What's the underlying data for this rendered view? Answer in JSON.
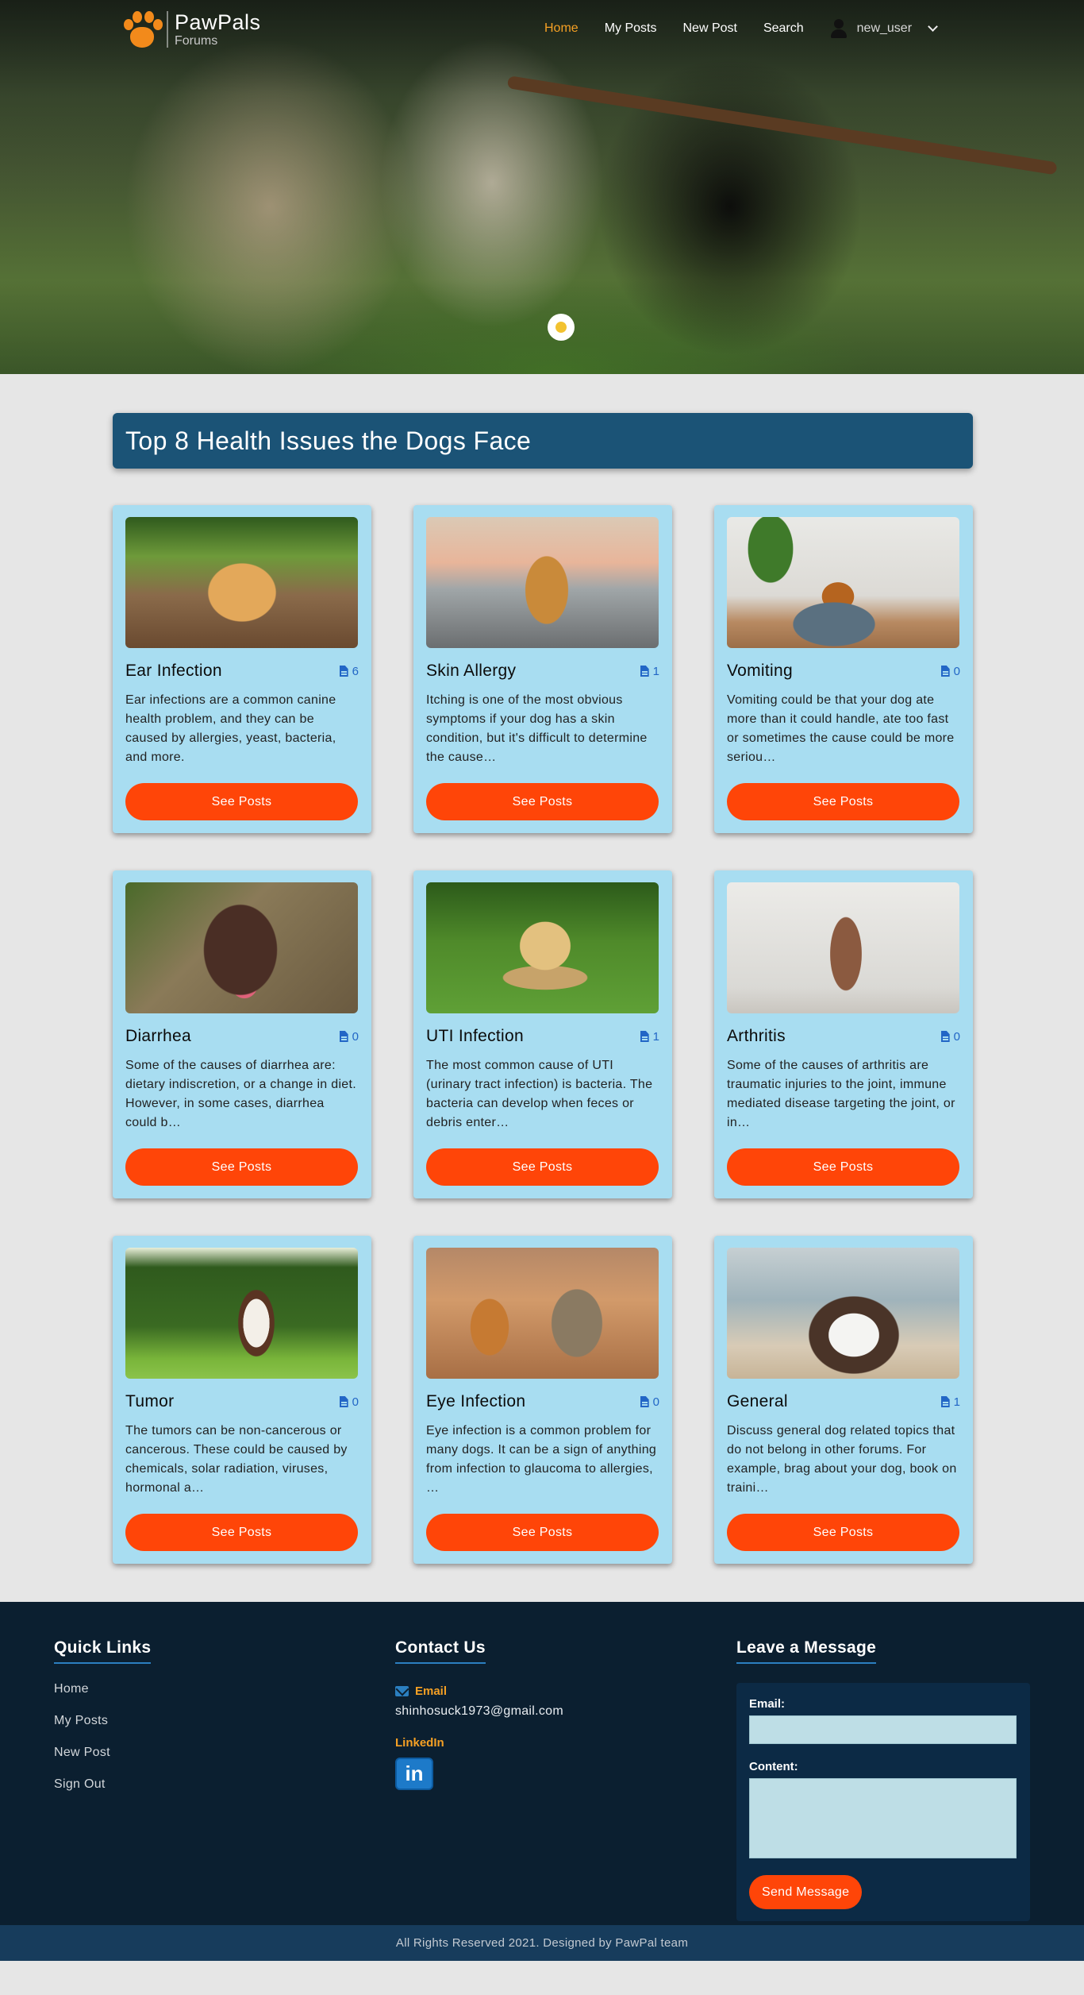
{
  "brand": {
    "name": "PawPals",
    "subtitle": "Forums"
  },
  "nav": {
    "links": [
      {
        "label": "Home",
        "active": true
      },
      {
        "label": "My Posts",
        "active": false
      },
      {
        "label": "New Post",
        "active": false
      },
      {
        "label": "Search",
        "active": false
      }
    ],
    "username": "new_user"
  },
  "page_title": "Top 8 Health Issues the Dogs Face",
  "cards": [
    {
      "title": "Ear Infection",
      "count": "6",
      "description": "Ear infections are a common canine health problem, and they can be caused by allergies, yeast, bacteria, and more.",
      "button": "See Posts"
    },
    {
      "title": "Skin Allergy",
      "count": "1",
      "description": "Itching is one of the most obvious symptoms if your dog has a skin condition, but it's difficult to determine the cause…",
      "button": "See Posts"
    },
    {
      "title": "Vomiting",
      "count": "0",
      "description": "Vomiting could be that your dog ate more than it could handle, ate too fast or sometimes the cause could be more seriou…",
      "button": "See Posts"
    },
    {
      "title": "Diarrhea",
      "count": "0",
      "description": "Some of the causes of diarrhea are: dietary indiscretion, or a change in diet. However, in some cases, diarrhea could b…",
      "button": "See Posts"
    },
    {
      "title": "UTI Infection",
      "count": "1",
      "description": "The most common cause of UTI (urinary tract infection) is bacteria. The bacteria can develop when feces or debris enter…",
      "button": "See Posts"
    },
    {
      "title": "Arthritis",
      "count": "0",
      "description": "Some of the causes of arthritis are traumatic injuries to the joint, immune mediated disease targeting the joint, or in…",
      "button": "See Posts"
    },
    {
      "title": "Tumor",
      "count": "0",
      "description": "The tumors can be non-cancerous or cancerous. These could be caused by chemicals, solar radiation, viruses, hormonal a…",
      "button": "See Posts"
    },
    {
      "title": "Eye Infection",
      "count": "0",
      "description": "Eye infection is a common problem for many dogs. It can be a sign of anything from infection to glaucoma to allergies, …",
      "button": "See Posts"
    },
    {
      "title": "General",
      "count": "1",
      "description": "Discuss general dog related topics that do not belong in other forums. For example, brag about your dog, book on traini…",
      "button": "See Posts"
    }
  ],
  "footer": {
    "quick_links": {
      "heading": "Quick Links",
      "items": [
        "Home",
        "My Posts",
        "New Post",
        "Sign Out"
      ]
    },
    "contact": {
      "heading": "Contact Us",
      "email_label": "Email",
      "email": "shinhosuck1973@gmail.com",
      "linkedin_label": "LinkedIn",
      "linkedin_glyph": "in"
    },
    "message": {
      "heading": "Leave a Message",
      "email_label": "Email:",
      "email_value": "",
      "content_label": "Content:",
      "content_value": "",
      "send_label": "Send Message"
    },
    "copyright": "All Rights Reserved 2021. Designed by PawPal team"
  },
  "colors": {
    "accent_orange": "#ff4508",
    "nav_active": "#f5a024",
    "title_bar": "#1b5376",
    "card_bg": "#a8ddf1",
    "count_blue": "#2266c6",
    "footer_bg": "#0b1f30"
  },
  "icons": {
    "logo": "paw-icon",
    "user": "user-icon",
    "dropdown": "chevron-down-icon",
    "count": "file-icon",
    "email": "envelope-icon",
    "linkedin": "linkedin-icon"
  }
}
